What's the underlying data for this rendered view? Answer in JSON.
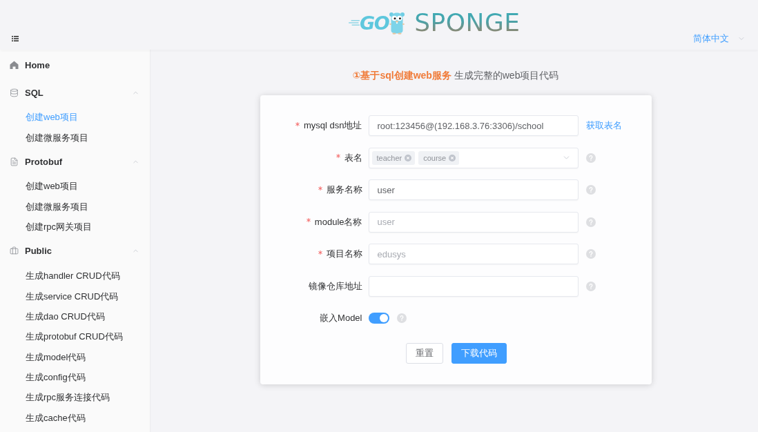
{
  "header": {
    "logo": {
      "mark": "GO",
      "name": "SPONGE"
    },
    "language": "简体中文"
  },
  "sidebar": {
    "items": [
      {
        "kind": "link",
        "label": "Home",
        "selected": false
      },
      {
        "kind": "group",
        "label": "SQL",
        "expanded": true,
        "children": [
          {
            "label": "创建web项目",
            "selected": true
          },
          {
            "label": "创建微服务项目",
            "selected": false
          }
        ]
      },
      {
        "kind": "group",
        "label": "Protobuf",
        "expanded": true,
        "children": [
          {
            "label": "创建web项目",
            "selected": false
          },
          {
            "label": "创建微服务项目",
            "selected": false
          },
          {
            "label": "创建rpc网关项目",
            "selected": false
          }
        ]
      },
      {
        "kind": "group",
        "label": "Public",
        "expanded": true,
        "children": [
          {
            "label": "生成handler CRUD代码",
            "selected": false
          },
          {
            "label": "生成service CRUD代码",
            "selected": false
          },
          {
            "label": "生成dao CRUD代码",
            "selected": false
          },
          {
            "label": "生成protobuf CRUD代码",
            "selected": false
          },
          {
            "label": "生成model代码",
            "selected": false
          },
          {
            "label": "生成config代码",
            "selected": false
          },
          {
            "label": "生成rpc服务连接代码",
            "selected": false
          },
          {
            "label": "生成cache代码",
            "selected": false
          }
        ]
      }
    ]
  },
  "page_heading": {
    "highlight": "①基于sql创建web服务",
    "text": "生成完整的web项目代码"
  },
  "form": {
    "fields": [
      {
        "kind": "text",
        "label": "mysql dsn地址",
        "required": true,
        "value": "root:123456@(192.168.3.76:3306)/school",
        "action": "获取表名",
        "help": false
      },
      {
        "kind": "tags",
        "label": "表名",
        "required": true,
        "tags": [
          "teacher",
          "course"
        ],
        "help": true
      },
      {
        "kind": "text",
        "label": "服务名称",
        "required": true,
        "value": "user",
        "help": true
      },
      {
        "kind": "text",
        "label": "module名称",
        "required": true,
        "placeholder": "user",
        "help": true
      },
      {
        "kind": "text",
        "label": "项目名称",
        "required": true,
        "placeholder": "edusys",
        "help": true
      },
      {
        "kind": "text",
        "label": "镜像仓库地址",
        "required": false,
        "help": true
      },
      {
        "kind": "switch",
        "label": "嵌入Model",
        "required": false,
        "on": true,
        "help": true
      }
    ],
    "buttons": [
      {
        "kind": "default",
        "label": "重置"
      },
      {
        "kind": "primary",
        "label": "下载代码"
      }
    ]
  }
}
